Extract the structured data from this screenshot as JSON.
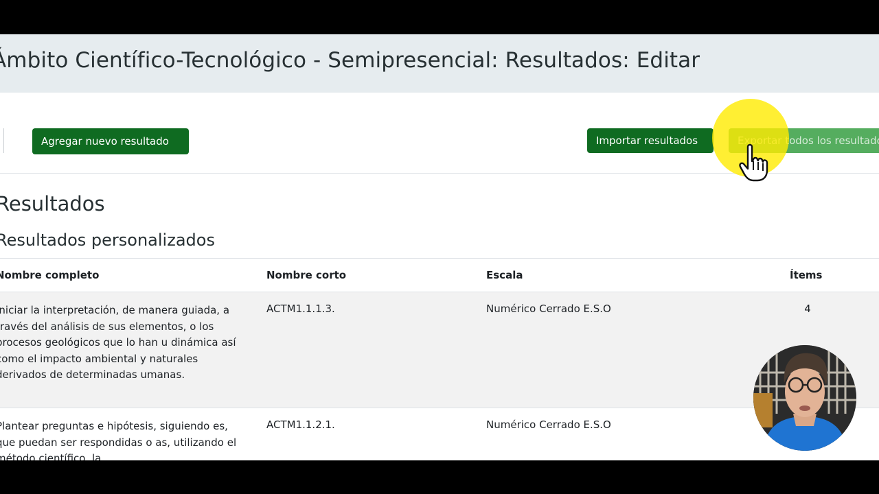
{
  "page": {
    "title": "Ámbito Científico-Tecnológico - Semipresencial: Resultados: Editar"
  },
  "actions": {
    "add_label": "Agregar nuevo resultado",
    "import_label": "Importar resultados",
    "export_label": "Exportar todos los resultados"
  },
  "section": {
    "title": "Resultados",
    "subtitle": "Resultados personalizados"
  },
  "table": {
    "headers": {
      "full_name": "Nombre completo",
      "short_name": "Nombre corto",
      "scale": "Escala",
      "items": "Ítems"
    },
    "rows": [
      {
        "full_name": "Iniciar la interpretación, de manera guiada, a través del análisis de sus elementos, o los procesos geológicos que lo han u dinámica así como el impacto ambiental y naturales derivados de determinadas umanas.",
        "short_name": "ACTM1.1.1.3.",
        "scale": "Numérico Cerrado E.S.O",
        "items": "4"
      },
      {
        "full_name": "Plantear preguntas e hipótesis, siguiendo es, que puedan ser respondidas o as, utilizando el método científico, la",
        "short_name": "ACTM1.1.2.1.",
        "scale": "Numérico Cerrado E.S.O",
        "items": ""
      }
    ]
  },
  "colors": {
    "primary_button": "#0f6b21",
    "header_bg": "#e6ecef",
    "highlight": "#ffeb00"
  },
  "icons": {
    "cursor": "hand-pointer-icon"
  }
}
